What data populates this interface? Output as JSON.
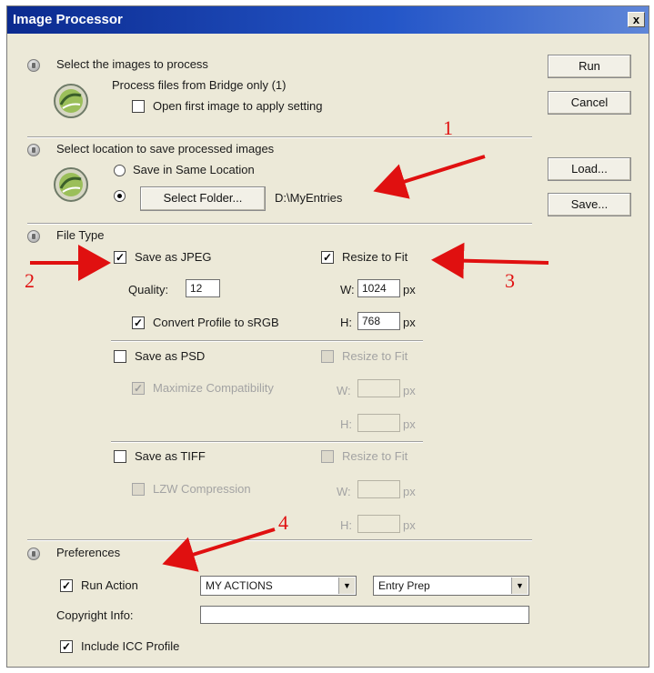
{
  "window": {
    "title": "Image Processor",
    "close_label": "x"
  },
  "section1": {
    "heading": "Select the images to process",
    "source_text": "Process files from Bridge only (1)",
    "open_first_label": "Open first image to apply setting",
    "open_first_checked": false
  },
  "section2": {
    "heading": "Select location to save processed images",
    "same_location_label": "Save in Same Location",
    "select_folder_button": "Select Folder...",
    "folder_path": "D:\\MyEntries",
    "selected_option": "Select Folder"
  },
  "section3": {
    "heading": "File Type",
    "jpeg": {
      "save_label": "Save as JPEG",
      "save_checked": true,
      "resize_label": "Resize to Fit",
      "resize_checked": true,
      "quality_label": "Quality:",
      "quality_value": "12",
      "w_label": "W:",
      "w_value": "1024",
      "h_label": "H:",
      "h_value": "768",
      "unit": "px",
      "convert_label": "Convert Profile to sRGB",
      "convert_checked": true
    },
    "psd": {
      "save_label": "Save as PSD",
      "save_checked": false,
      "resize_label": "Resize to Fit",
      "maximize_label": "Maximize Compatibility",
      "maximize_checked": true,
      "w_label": "W:",
      "h_label": "H:",
      "unit": "px"
    },
    "tiff": {
      "save_label": "Save as TIFF",
      "save_checked": false,
      "resize_label": "Resize to Fit",
      "lzw_label": "LZW Compression",
      "lzw_checked": false,
      "w_label": "W:",
      "h_label": "H:",
      "unit": "px"
    }
  },
  "section4": {
    "heading": "Preferences",
    "run_action_label": "Run Action",
    "run_action_checked": true,
    "action_set": "MY ACTIONS",
    "action": "Entry Prep",
    "copyright_label": "Copyright Info:",
    "copyright_value": "",
    "icc_label": "Include ICC Profile",
    "icc_checked": true
  },
  "buttons": {
    "run": "Run",
    "cancel": "Cancel",
    "load": "Load...",
    "save": "Save..."
  },
  "annotations": {
    "a1": "1",
    "a2": "2",
    "a3": "3",
    "a4": "4",
    "color": "#e01010"
  },
  "check_glyph": "✓",
  "arrow_glyph": "▼"
}
